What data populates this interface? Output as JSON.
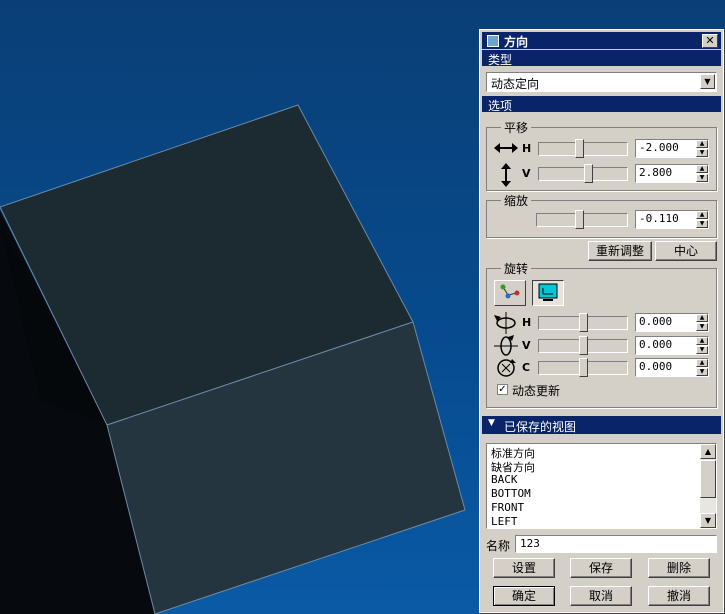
{
  "window": {
    "title": "方向",
    "close": "✕"
  },
  "type_section": {
    "header": "类型",
    "selected": "动态定向"
  },
  "options": {
    "header": "选项"
  },
  "pan": {
    "label": "平移",
    "h": {
      "axis": "H",
      "value": "-2.000",
      "slider": 0.45
    },
    "v": {
      "axis": "V",
      "value": "2.800",
      "slider": 0.57
    }
  },
  "zoom": {
    "label": "缩放",
    "value": "-0.110",
    "slider": 0.47
  },
  "buttons": {
    "readjust": "重新调整",
    "center": "中心"
  },
  "rotate": {
    "label": "旋转",
    "h": {
      "axis": "H",
      "value": "0.000",
      "slider": 0.5
    },
    "v": {
      "axis": "V",
      "value": "0.000",
      "slider": 0.5
    },
    "c": {
      "axis": "C",
      "value": "0.000",
      "slider": 0.5
    },
    "dynamic_update": {
      "label": "动态更新",
      "checked": true
    }
  },
  "saved_views": {
    "header": "已保存的视图",
    "items": [
      "标准方向",
      "缺省方向",
      "BACK",
      "BOTTOM",
      "FRONT",
      "LEFT"
    ]
  },
  "name": {
    "label": "名称",
    "value": "123"
  },
  "actions": {
    "set": "设置",
    "save": "保存",
    "delete": "删除"
  },
  "footer": {
    "ok": "确定",
    "cancel": "取消",
    "undo": "撤消"
  },
  "colors": {
    "titlebar": "#0a246a",
    "face": "#d4d0c8",
    "viewport": "#074b8e",
    "cube_top": "#1c2a32",
    "cube_front": "#253540"
  }
}
